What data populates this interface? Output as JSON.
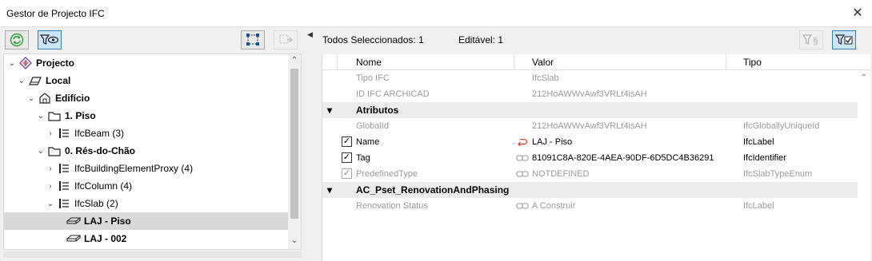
{
  "window": {
    "title": "Gestor de Projecto IFC",
    "close_glyph": "✕"
  },
  "left_toolbar": {
    "refresh_icon": "refresh-icon",
    "filter_view_icon": "filter-view-icon",
    "select_elements_icon": "select-elements-icon",
    "select_disabled_icon": "select-disabled-icon"
  },
  "tree": {
    "items": [
      {
        "label": "Projecto",
        "icon": "project-icon",
        "chevron": "⌄",
        "bold": true,
        "selected": false
      },
      {
        "label": "Local",
        "icon": "site-icon",
        "chevron": "⌄",
        "bold": true,
        "selected": false
      },
      {
        "label": "Edifício",
        "icon": "building-icon",
        "chevron": "⌄",
        "bold": true,
        "selected": false
      },
      {
        "label": "1. Piso",
        "icon": "storey-icon",
        "chevron": "⌄",
        "bold": true,
        "selected": false
      },
      {
        "label": "IfcBeam (3)",
        "icon": "list-icon",
        "chevron": "›",
        "bold": false,
        "selected": false
      },
      {
        "label": "0. Rés-do-Chão",
        "icon": "storey-icon",
        "chevron": "⌄",
        "bold": true,
        "selected": false
      },
      {
        "label": "IfcBuildingElementProxy (4)",
        "icon": "list-icon",
        "chevron": "›",
        "bold": false,
        "selected": false
      },
      {
        "label": "IfcColumn (4)",
        "icon": "list-icon",
        "chevron": "›",
        "bold": false,
        "selected": false
      },
      {
        "label": "IfcSlab (2)",
        "icon": "list-icon",
        "chevron": "⌄",
        "bold": false,
        "selected": false
      },
      {
        "label": "LAJ - Piso",
        "icon": "slab-icon",
        "chevron": "",
        "bold": true,
        "selected": true
      },
      {
        "label": "LAJ - 002",
        "icon": "slab-icon",
        "chevron": "",
        "bold": true,
        "selected": false
      }
    ],
    "scroll_up": "⌃",
    "scroll_down": "⌄"
  },
  "summary": {
    "selected_label": "Todos Seleccionados: 1",
    "editable_label": "Editável: 1"
  },
  "grid": {
    "headers": {
      "name": "Nome",
      "value": "Valor",
      "type": "Tipo"
    },
    "rows": [
      {
        "kind": "plain",
        "name": "Tipo IFC",
        "value": "IfcSlab",
        "type": "",
        "check": "",
        "link": ""
      },
      {
        "kind": "plain",
        "name": "ID IFC ARCHICAD",
        "value": "212HoAWWvAwf3VRLt4isAH",
        "type": "",
        "check": "",
        "link": ""
      },
      {
        "kind": "section",
        "name": "Atributos"
      },
      {
        "kind": "plain",
        "name": "GlobalId",
        "value": "212HoAWWvAwf3VRLt4isAH",
        "type": "IfcGloballyUniqueId",
        "check": "",
        "link": ""
      },
      {
        "kind": "checked",
        "name": "Name",
        "value": "LAJ - Piso",
        "type": "IfcLabel",
        "check": "✓",
        "link": "return-icon"
      },
      {
        "kind": "checked",
        "name": "Tag",
        "value": "81091C8A-820E-4AEA-90DF-6D5DC4B36291",
        "type": "IfcIdentifier",
        "check": "✓",
        "link": "link-icon"
      },
      {
        "kind": "dimchecked",
        "name": "PredefinedType",
        "value": "NOTDEFINED",
        "type": "IfcSlabTypeEnum",
        "check": "✓",
        "link": "link-icon"
      },
      {
        "kind": "section",
        "name": "AC_Pset_RenovationAndPhasing"
      },
      {
        "kind": "plain",
        "name": "Renovation Status",
        "value": "A Construir",
        "type": "IfcLabel",
        "check": "",
        "link": "link-icon"
      }
    ],
    "section_chevron": "▾",
    "scroll_up": "⌃"
  },
  "right_toolbar": {
    "filter_param_icon": "filter-parameter-icon",
    "filter_checked_icon": "filter-checked-icon"
  },
  "colors": {
    "accent": "#3c7fb1",
    "active_bg": "#cce4f7",
    "selected_row": "#d9d9d9",
    "section_bg": "#ececec",
    "grey_text": "#9b9b9b"
  }
}
